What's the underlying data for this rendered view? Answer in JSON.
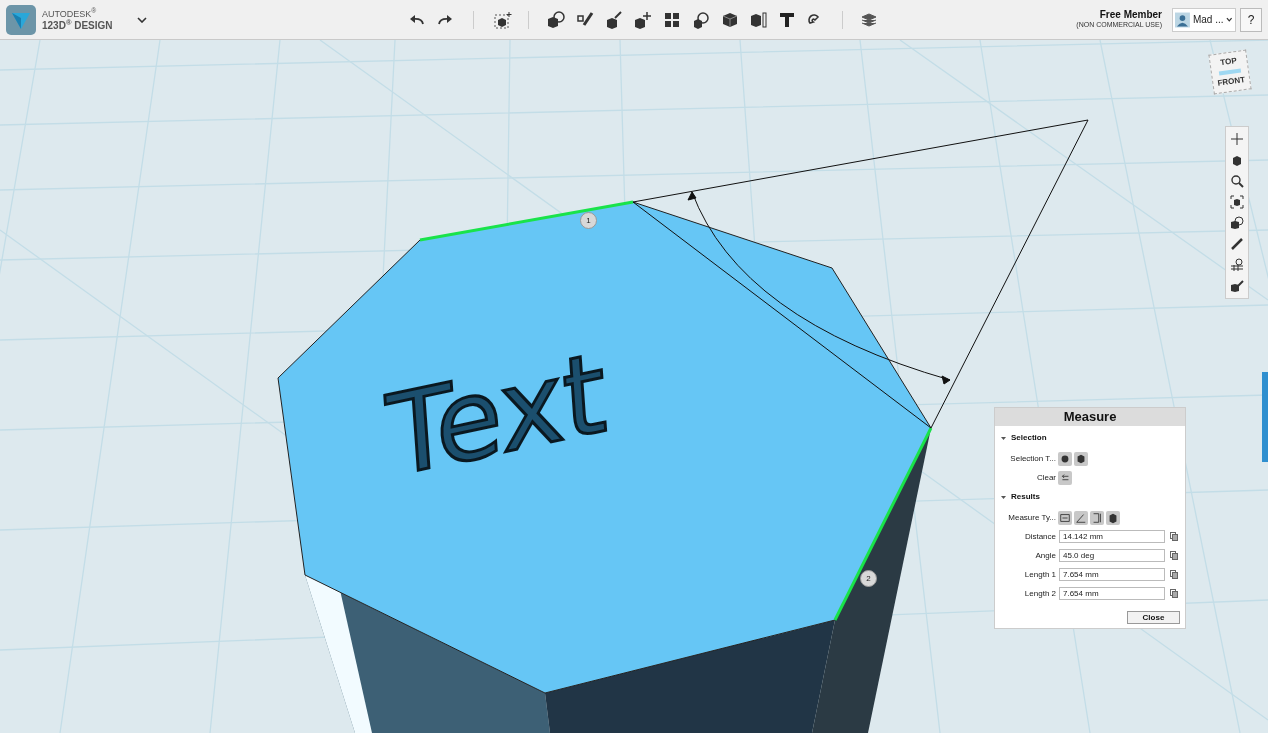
{
  "app": {
    "brand_top": "AUTODESK$^{®}$",
    "brand_bottom": "123D$^{®}$ DESIGN"
  },
  "account": {
    "title": "Free Member",
    "subtitle": "(NON COMMERCIAL USE)",
    "user": "Mad ...",
    "help": "?"
  },
  "view_cube": {
    "top": "TOP",
    "front": "FRONT"
  },
  "viewport": {
    "model_text": "Text",
    "markers": [
      "1",
      "2"
    ]
  },
  "measure": {
    "title": "Measure",
    "sections": [
      {
        "title": "Selection",
        "expanded": true,
        "rows": [
          {
            "kind": "selection_types",
            "label": "Selection T..."
          },
          {
            "kind": "clear",
            "label": "Clear"
          }
        ]
      },
      {
        "title": "Results",
        "expanded": true,
        "rows": [
          {
            "kind": "measure_types",
            "label": "Measure Ty..."
          },
          {
            "kind": "field",
            "label": "Distance",
            "value": "14.142 mm"
          },
          {
            "kind": "field",
            "label": "Angle",
            "value": "45.0 deg"
          },
          {
            "kind": "field",
            "label": "Length 1",
            "value": "7.654 mm"
          },
          {
            "kind": "field",
            "label": "Length 2",
            "value": "7.654 mm"
          }
        ]
      }
    ],
    "close": "Close"
  }
}
